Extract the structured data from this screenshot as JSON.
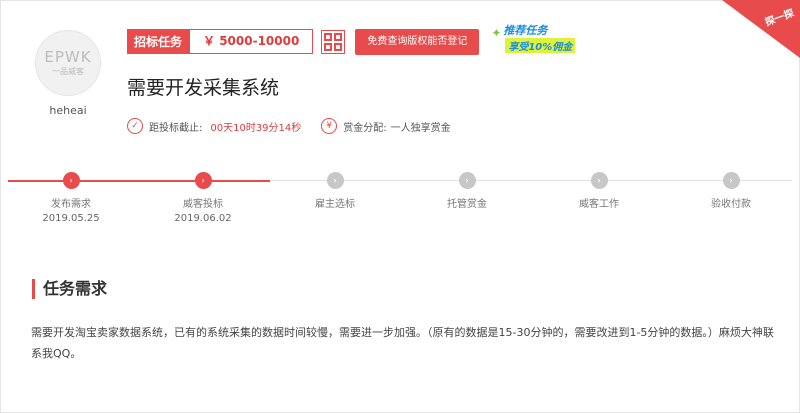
{
  "user": {
    "logo_main": "EPWK",
    "logo_sub": "一品威客",
    "name": "heheai"
  },
  "task": {
    "type_label": "招标任务",
    "price": "￥ 5000-10000",
    "copyright_button": "免费查询版权能否登记",
    "promo_line1": "推荐任务",
    "promo_line2": "享受10%佣金",
    "corner_label": "探一探",
    "title": "需要开发采集系统",
    "deadline_label": "距投标截止:",
    "deadline_value": "00天10时39分14秒",
    "reward_icon": "¥",
    "reward_label": "赏金分配:",
    "reward_value": "一人独享赏金"
  },
  "steps": [
    {
      "label": "发布需求",
      "date": "2019.05.25",
      "active": true
    },
    {
      "label": "威客投标",
      "date": "2019.06.02",
      "active": true
    },
    {
      "label": "雇主选标",
      "date": "",
      "active": false
    },
    {
      "label": "托管赏金",
      "date": "",
      "active": false
    },
    {
      "label": "威客工作",
      "date": "",
      "active": false
    },
    {
      "label": "验收付款",
      "date": "",
      "active": false
    }
  ],
  "requirement": {
    "heading": "任务需求",
    "text": "需要开发淘宝卖家数据系统，已有的系统采集的数据时间较慢，需要进一步加强。（原有的数据是15-30分钟的，需要改进到1-5分钟的数据。）麻烦大神联系我QQ。"
  },
  "colors": {
    "accent": "#e84b4b",
    "inactive_step": "#c7c7c7",
    "promo_blue": "#1a8fd8"
  },
  "icons": {
    "step_active": "chevron-right-icon",
    "step_inactive": "chevron-right-icon",
    "deadline": "check-clock-icon",
    "reward": "yen-icon",
    "qr": "qr-code-icon"
  }
}
